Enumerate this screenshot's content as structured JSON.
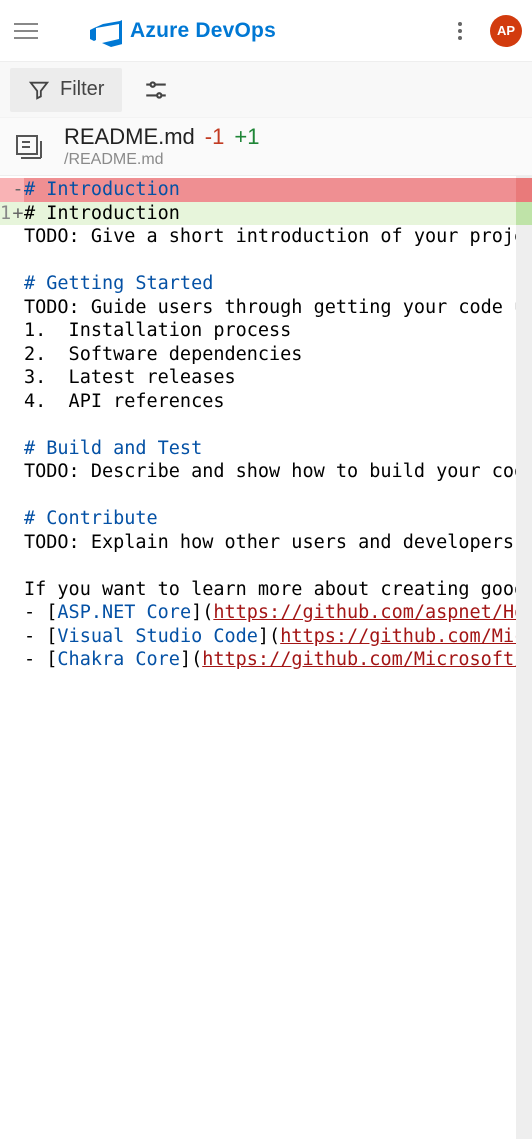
{
  "header": {
    "brand": "Azure DevOps",
    "avatar_initials": "AP"
  },
  "toolbar": {
    "filter_label": "Filter"
  },
  "file": {
    "name": "README.md",
    "path": "/README.md",
    "deletions": "-1",
    "additions": "+1"
  },
  "diff": {
    "removed_line": "# Introduction",
    "added_line_no": "1",
    "added_line": "# Introduction ",
    "body_segments": [
      {
        "indent": "",
        "runs": [
          {
            "t": "TODO: Give a short introduction of your project",
            "cls": ""
          }
        ]
      },
      {
        "indent": "",
        "runs": []
      },
      {
        "indent": "",
        "runs": [
          {
            "t": "# Getting Started",
            "cls": "md-heading"
          }
        ]
      },
      {
        "indent": "",
        "runs": [
          {
            "t": "TODO: Guide users through getting your code up a",
            "cls": ""
          }
        ]
      },
      {
        "indent": "",
        "runs": [
          {
            "t": "1.  Installation process",
            "cls": ""
          }
        ]
      },
      {
        "indent": "",
        "runs": [
          {
            "t": "2.  Software dependencies",
            "cls": ""
          }
        ]
      },
      {
        "indent": "",
        "runs": [
          {
            "t": "3.  Latest releases",
            "cls": ""
          }
        ]
      },
      {
        "indent": "",
        "runs": [
          {
            "t": "4.  API references",
            "cls": ""
          }
        ]
      },
      {
        "indent": "",
        "runs": []
      },
      {
        "indent": "",
        "runs": [
          {
            "t": "# Build and Test",
            "cls": "md-heading"
          }
        ]
      },
      {
        "indent": "",
        "runs": [
          {
            "t": "TODO: Describe and show how to build your code a",
            "cls": ""
          }
        ]
      },
      {
        "indent": "",
        "runs": []
      },
      {
        "indent": "",
        "runs": [
          {
            "t": "# Contribute",
            "cls": "md-heading"
          }
        ]
      },
      {
        "indent": "",
        "runs": [
          {
            "t": "TODO: Explain how other users and developers can",
            "cls": ""
          }
        ]
      },
      {
        "indent": "",
        "runs": []
      },
      {
        "indent": "",
        "runs": [
          {
            "t": "If you want to learn more about creating good re",
            "cls": ""
          }
        ]
      },
      {
        "indent": "",
        "runs": [
          {
            "t": "- [",
            "cls": ""
          },
          {
            "t": "ASP.NET Core",
            "cls": "md-link"
          },
          {
            "t": "](",
            "cls": ""
          },
          {
            "t": "https://github.com/aspnet/Home",
            "cls": "md-url"
          }
        ]
      },
      {
        "indent": "",
        "runs": [
          {
            "t": "- [",
            "cls": ""
          },
          {
            "t": "Visual Studio Code",
            "cls": "md-link"
          },
          {
            "t": "](",
            "cls": ""
          },
          {
            "t": "https://github.com/Micros",
            "cls": "md-url"
          }
        ]
      },
      {
        "indent": "",
        "runs": [
          {
            "t": "- [",
            "cls": ""
          },
          {
            "t": "Chakra Core",
            "cls": "md-link"
          },
          {
            "t": "](",
            "cls": ""
          },
          {
            "t": "https://github.com/Microsoft/Cha",
            "cls": "md-url"
          }
        ]
      }
    ]
  }
}
